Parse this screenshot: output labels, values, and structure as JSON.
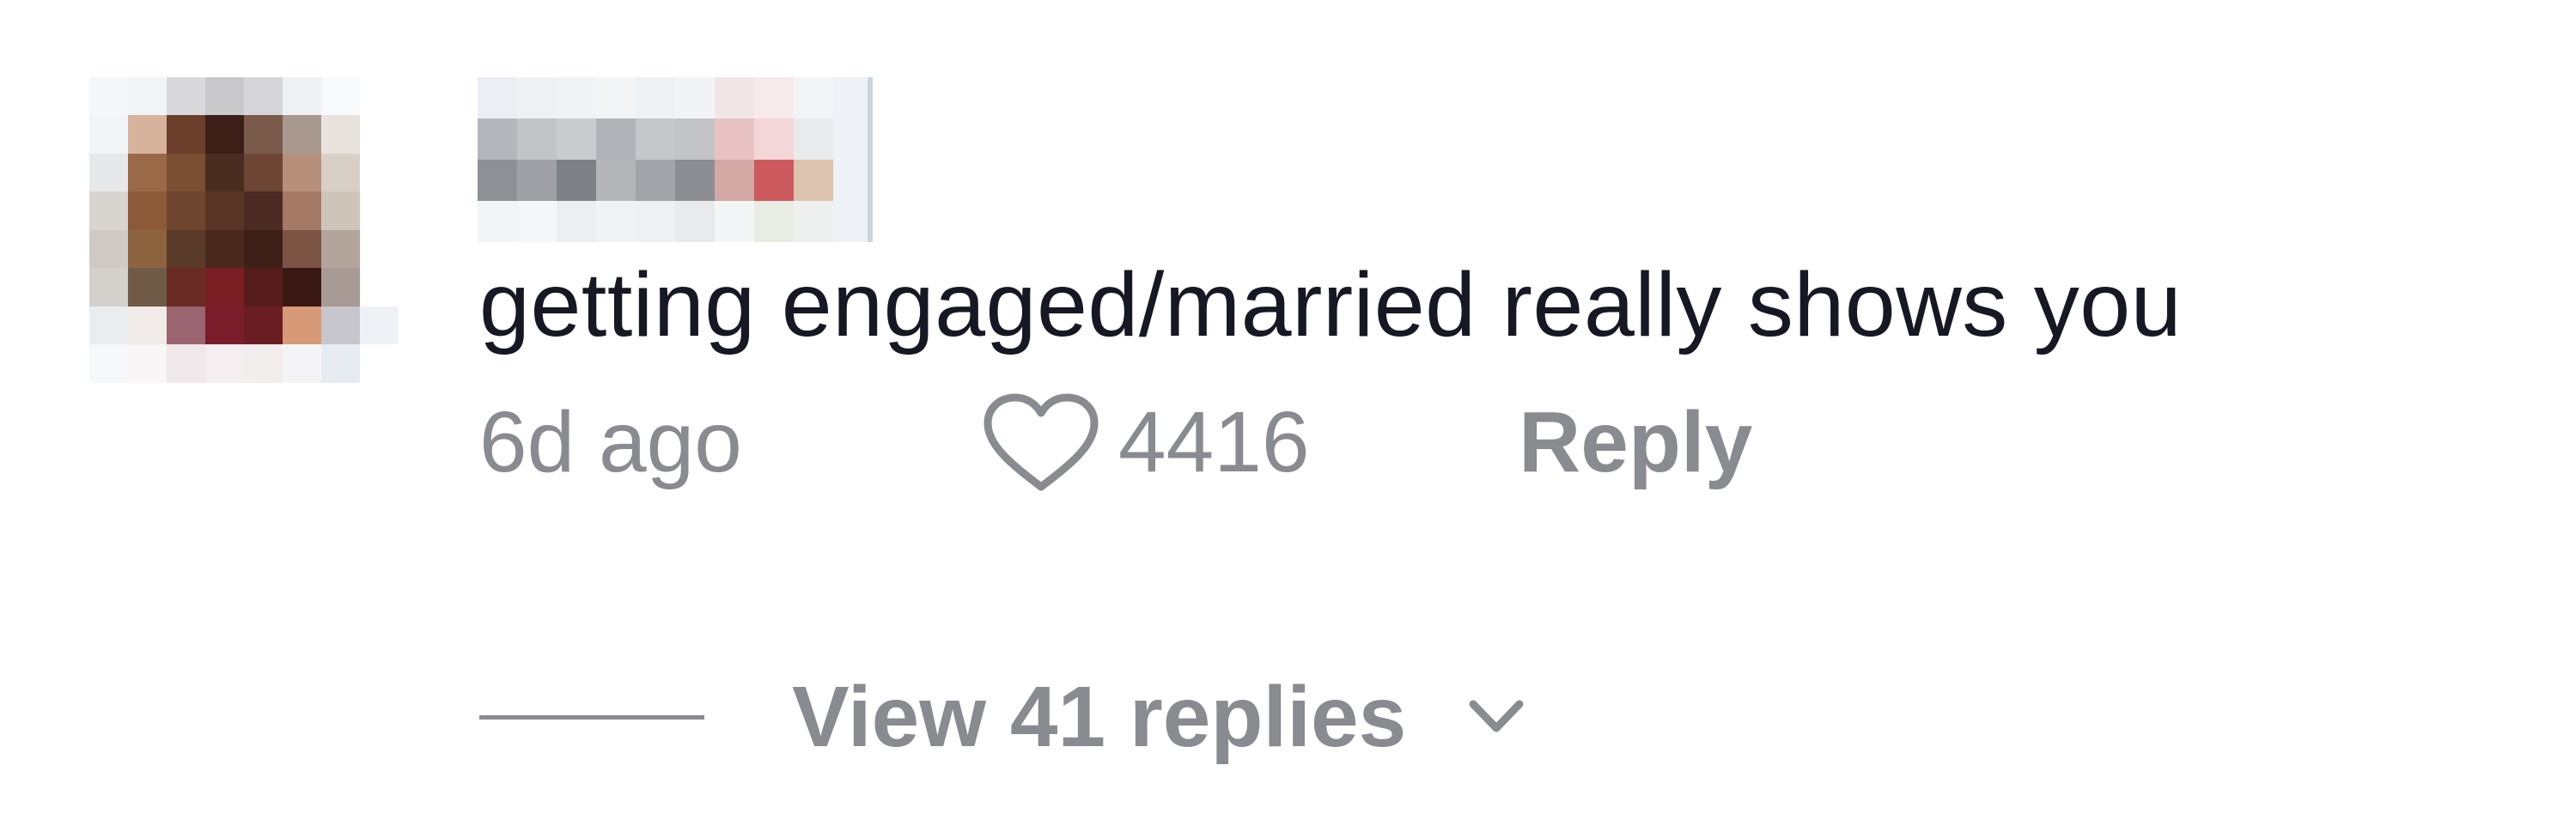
{
  "comment": {
    "author_name": "",
    "text": "getting engaged/married really shows you",
    "timestamp": "6d ago",
    "like_count": "4416",
    "reply_label": "Reply",
    "view_replies_label": "View 41 replies",
    "avatar_icon": "pixelated-avatar",
    "like_icon": "heart-outline-icon",
    "expand_icon": "chevron-down-icon"
  },
  "colors": {
    "text_primary": "#161823",
    "text_secondary": "#8a8b91",
    "background": "#ffffff"
  }
}
